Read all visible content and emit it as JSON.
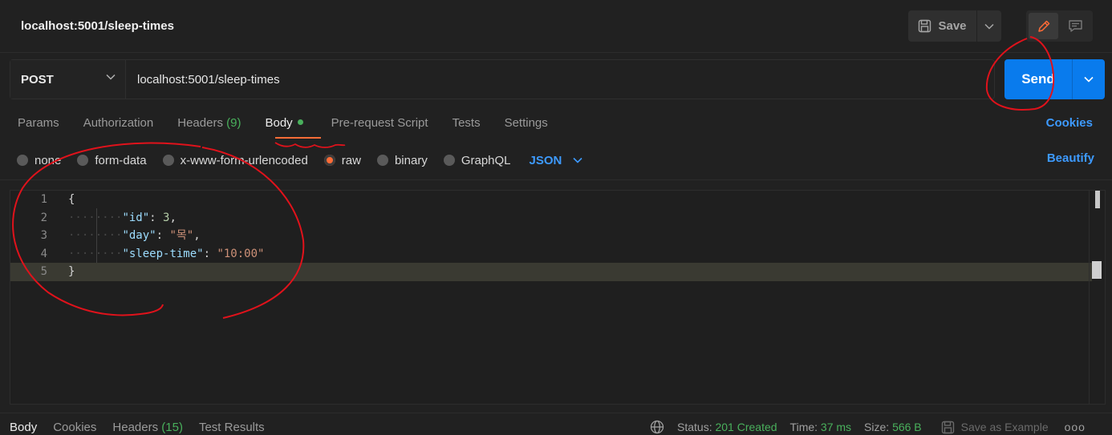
{
  "header": {
    "title": "localhost:5001/sleep-times",
    "save_label": "Save"
  },
  "request": {
    "method": "POST",
    "url": "localhost:5001/sleep-times",
    "send_label": "Send"
  },
  "tabs": {
    "params": "Params",
    "authorization": "Authorization",
    "headers": "Headers",
    "headers_count": "(9)",
    "body": "Body",
    "prerequest": "Pre-request Script",
    "tests": "Tests",
    "settings": "Settings",
    "cookies": "Cookies"
  },
  "body_types": {
    "none": "none",
    "form_data": "form-data",
    "urlencoded": "x-www-form-urlencoded",
    "raw": "raw",
    "binary": "binary",
    "graphql": "GraphQL",
    "language": "JSON",
    "beautify": "Beautify",
    "selected": "raw"
  },
  "editor": {
    "line_numbers": [
      "1",
      "2",
      "3",
      "4",
      "5"
    ],
    "open_brace": "{",
    "close_brace": "}",
    "fields": [
      {
        "key": "\"id\"",
        "value": "3",
        "suffix": ","
      },
      {
        "key": "\"day\"",
        "value": "\"목\"",
        "suffix": ","
      },
      {
        "key": "\"sleep-time\"",
        "value": "\"10:00\"",
        "suffix": ""
      }
    ]
  },
  "response": {
    "tabs": {
      "body": "Body",
      "cookies": "Cookies",
      "headers": "Headers",
      "headers_count": "(15)",
      "test_results": "Test Results"
    },
    "status_label": "Status:",
    "status_value": "201 Created",
    "time_label": "Time:",
    "time_value": "37 ms",
    "size_label": "Size:",
    "size_value": "566 B",
    "save_example": "Save as Example",
    "more": "ooo"
  },
  "colors": {
    "accent_orange": "#ff6c37",
    "send_blue": "#097bed",
    "link_blue": "#3d9aff",
    "status_green": "#49b05c",
    "annotation_red": "#e0121b"
  }
}
